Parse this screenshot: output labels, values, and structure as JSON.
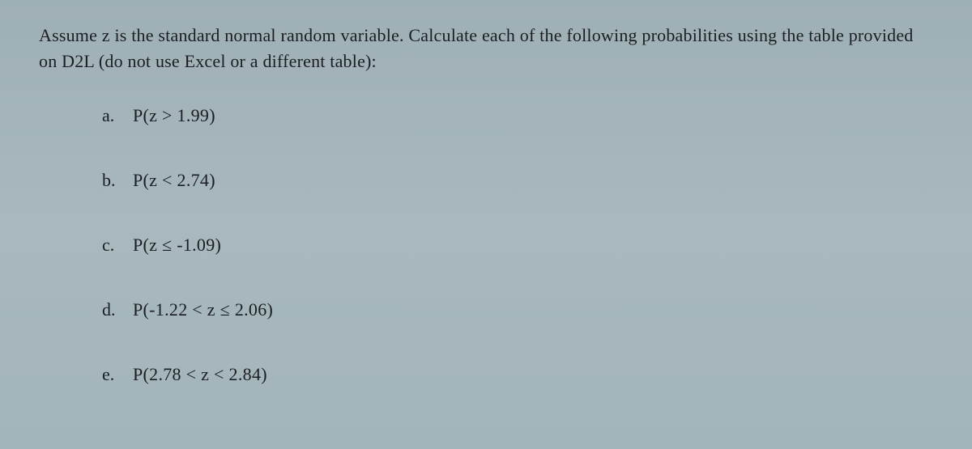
{
  "intro": "Assume z is the standard normal random variable. Calculate each of the following probabilities using the table provided on D2L (do not use Excel or a different table):",
  "questions": [
    {
      "label": "a.",
      "expr": "P(z > 1.99)"
    },
    {
      "label": "b.",
      "expr": "P(z < 2.74)"
    },
    {
      "label": "c.",
      "expr": "P(z ≤  -1.09)"
    },
    {
      "label": "d.",
      "expr": "P(-1.22 < z ≤ 2.06)"
    },
    {
      "label": "e.",
      "expr": "P(2.78 < z < 2.84)"
    }
  ]
}
